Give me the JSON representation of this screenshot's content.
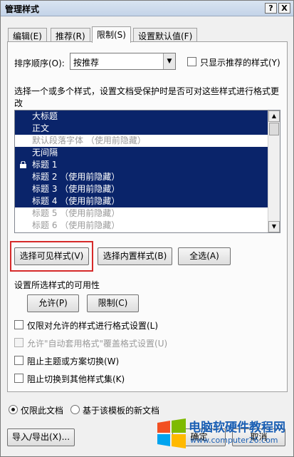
{
  "window": {
    "title": "管理样式",
    "help_label": "?",
    "close_label": "X"
  },
  "tabs": [
    {
      "label": "编辑(E)",
      "active": false
    },
    {
      "label": "推荐(R)",
      "active": false
    },
    {
      "label": "限制(S)",
      "active": true
    },
    {
      "label": "设置默认值(F)",
      "active": false
    }
  ],
  "sort": {
    "label": "排序顺序(O):",
    "value": "按推荐",
    "show_recommended_label": "只显示推荐的样式(Y)"
  },
  "description": {
    "line1": "选择一个或多个样式，设置文档受保护时是否可对这些样式进行格式更",
    "line2": "改"
  },
  "styles_list": [
    {
      "label": "大标题",
      "selected": true,
      "locked": false,
      "gray": false
    },
    {
      "label": "正文",
      "selected": true,
      "locked": false,
      "gray": false
    },
    {
      "label": "默认段落字体 （使用前隐藏）",
      "selected": false,
      "locked": false,
      "gray": true
    },
    {
      "label": "无间隔",
      "selected": true,
      "locked": false,
      "gray": false
    },
    {
      "label": "标题 1",
      "selected": true,
      "locked": true,
      "gray": false
    },
    {
      "label": "标题 2 （使用前隐藏）",
      "selected": true,
      "locked": false,
      "gray": false
    },
    {
      "label": "标题 3 （使用前隐藏）",
      "selected": true,
      "locked": false,
      "gray": false
    },
    {
      "label": "标题 4 （使用前隐藏）",
      "selected": true,
      "locked": false,
      "gray": false
    },
    {
      "label": "标题 5 （使用前隐藏）",
      "selected": false,
      "locked": false,
      "gray": true
    },
    {
      "label": "标题 6 （使用前隐藏）",
      "selected": false,
      "locked": false,
      "gray": true
    }
  ],
  "buttons": {
    "select_visible": "选择可见样式(V)",
    "select_builtin": "选择内置样式(B)",
    "select_all": "全选(A)",
    "permit": "允许(P)",
    "restrict": "限制(C)",
    "import_export": "导入/导出(X)...",
    "ok": "确定",
    "cancel": "取消"
  },
  "availability": {
    "label": "设置所选样式的可用性"
  },
  "options": {
    "limit_formatting": "仅限对允许的样式进行格式设置(L)",
    "allow_autoformat": "允许\"自动套用格式\"覆盖格式设置(U)",
    "block_theme": "阻止主题或方案切换(W)",
    "block_style_set": "阻止切换到其他样式集(K)"
  },
  "scope": {
    "this_document": "仅限此文档",
    "new_documents": "基于该模板的新文档"
  },
  "watermark": {
    "line1": "电脑软硬件教程网",
    "line2": "www.computer26.com"
  },
  "colors": {
    "selection": "#0a246a",
    "highlight_box": "#d62a2a",
    "watermark": "#1a5fb4"
  }
}
